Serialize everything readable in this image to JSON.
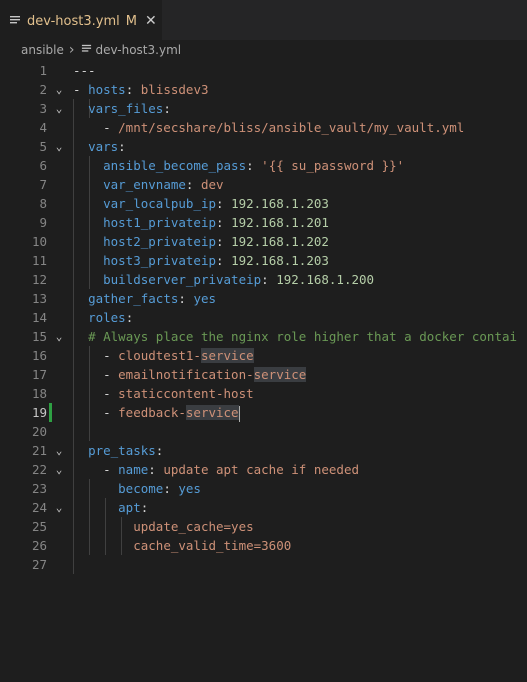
{
  "tab": {
    "title": "dev-host3.yml",
    "modified": "M",
    "close": "✕",
    "icon": "lines-file-icon"
  },
  "breadcrumb": {
    "folder": "ansible",
    "separator": "›",
    "file": "dev-host3.yml"
  },
  "lines": [
    {
      "n": "1",
      "fold": "",
      "tokens": [
        [
          "p",
          "---"
        ]
      ]
    },
    {
      "n": "2",
      "fold": "⌄",
      "tokens": [
        [
          "p",
          "- "
        ],
        [
          "k",
          "hosts"
        ],
        [
          "p",
          ": "
        ],
        [
          "s",
          "blissdev3"
        ]
      ]
    },
    {
      "n": "3",
      "fold": "⌄",
      "tokens": [
        [
          "p",
          "  "
        ],
        [
          "k",
          "vars_files"
        ],
        [
          "p",
          ":"
        ]
      ]
    },
    {
      "n": "4",
      "fold": "",
      "tokens": [
        [
          "p",
          "    - "
        ],
        [
          "s",
          "/mnt/secshare/bliss/ansible_vault/my_vault.yml"
        ]
      ]
    },
    {
      "n": "5",
      "fold": "⌄",
      "tokens": [
        [
          "p",
          "  "
        ],
        [
          "k",
          "vars"
        ],
        [
          "p",
          ":"
        ]
      ]
    },
    {
      "n": "6",
      "fold": "",
      "tokens": [
        [
          "p",
          "    "
        ],
        [
          "k",
          "ansible_become_pass"
        ],
        [
          "p",
          ": "
        ],
        [
          "s",
          "'{{ su_password }}'"
        ]
      ]
    },
    {
      "n": "7",
      "fold": "",
      "tokens": [
        [
          "p",
          "    "
        ],
        [
          "k",
          "var_envname"
        ],
        [
          "p",
          ": "
        ],
        [
          "s",
          "dev"
        ]
      ]
    },
    {
      "n": "8",
      "fold": "",
      "tokens": [
        [
          "p",
          "    "
        ],
        [
          "k",
          "var_localpub_ip"
        ],
        [
          "p",
          ": "
        ],
        [
          "n",
          "192.168.1.203"
        ]
      ]
    },
    {
      "n": "9",
      "fold": "",
      "tokens": [
        [
          "p",
          "    "
        ],
        [
          "k",
          "host1_privateip"
        ],
        [
          "p",
          ": "
        ],
        [
          "n",
          "192.168.1.201"
        ]
      ]
    },
    {
      "n": "10",
      "fold": "",
      "tokens": [
        [
          "p",
          "    "
        ],
        [
          "k",
          "host2_privateip"
        ],
        [
          "p",
          ": "
        ],
        [
          "n",
          "192.168.1.202"
        ]
      ]
    },
    {
      "n": "11",
      "fold": "",
      "tokens": [
        [
          "p",
          "    "
        ],
        [
          "k",
          "host3_privateip"
        ],
        [
          "p",
          ": "
        ],
        [
          "n",
          "192.168.1.203"
        ]
      ]
    },
    {
      "n": "12",
      "fold": "",
      "tokens": [
        [
          "p",
          "    "
        ],
        [
          "k",
          "buildserver_privateip"
        ],
        [
          "p",
          ": "
        ],
        [
          "n",
          "192.168.1.200"
        ]
      ]
    },
    {
      "n": "13",
      "fold": "",
      "tokens": [
        [
          "p",
          "  "
        ],
        [
          "k",
          "gather_facts"
        ],
        [
          "p",
          ": "
        ],
        [
          "k",
          "yes"
        ]
      ]
    },
    {
      "n": "14",
      "fold": "",
      "tokens": [
        [
          "p",
          "  "
        ],
        [
          "k",
          "roles"
        ],
        [
          "p",
          ":"
        ]
      ]
    },
    {
      "n": "15",
      "fold": "⌄",
      "tokens": [
        [
          "p",
          "  "
        ],
        [
          "c",
          "# Always place the nginx role higher that a docker contai"
        ]
      ]
    },
    {
      "n": "16",
      "fold": "",
      "tokens": [
        [
          "p",
          "    - "
        ],
        [
          "s",
          "cloudtest1-"
        ],
        [
          "sh",
          "service"
        ]
      ]
    },
    {
      "n": "17",
      "fold": "",
      "tokens": [
        [
          "p",
          "    - "
        ],
        [
          "s",
          "emailnotification-"
        ],
        [
          "sh",
          "service"
        ]
      ]
    },
    {
      "n": "18",
      "fold": "",
      "tokens": [
        [
          "p",
          "    - "
        ],
        [
          "s",
          "staticcontent-host"
        ]
      ]
    },
    {
      "n": "19",
      "fold": "",
      "tokens": [
        [
          "p",
          "    - "
        ],
        [
          "s",
          "feedback-"
        ],
        [
          "sh",
          "service"
        ],
        [
          "cur",
          ""
        ]
      ]
    },
    {
      "n": "20",
      "fold": "",
      "tokens": []
    },
    {
      "n": "21",
      "fold": "⌄",
      "tokens": [
        [
          "p",
          "  "
        ],
        [
          "k",
          "pre_tasks"
        ],
        [
          "p",
          ":"
        ]
      ]
    },
    {
      "n": "22",
      "fold": "⌄",
      "tokens": [
        [
          "p",
          "    - "
        ],
        [
          "k",
          "name"
        ],
        [
          "p",
          ": "
        ],
        [
          "s",
          "update apt cache if needed"
        ]
      ]
    },
    {
      "n": "23",
      "fold": "",
      "tokens": [
        [
          "p",
          "      "
        ],
        [
          "k",
          "become"
        ],
        [
          "p",
          ": "
        ],
        [
          "k",
          "yes"
        ]
      ]
    },
    {
      "n": "24",
      "fold": "⌄",
      "tokens": [
        [
          "p",
          "      "
        ],
        [
          "k",
          "apt"
        ],
        [
          "p",
          ":"
        ]
      ]
    },
    {
      "n": "25",
      "fold": "",
      "tokens": [
        [
          "p",
          "        "
        ],
        [
          "s",
          "update_cache=yes"
        ]
      ]
    },
    {
      "n": "26",
      "fold": "",
      "tokens": [
        [
          "p",
          "        "
        ],
        [
          "s",
          "cache_valid_time=3600"
        ]
      ]
    },
    {
      "n": "27",
      "fold": "",
      "tokens": []
    }
  ],
  "active_line": "19"
}
